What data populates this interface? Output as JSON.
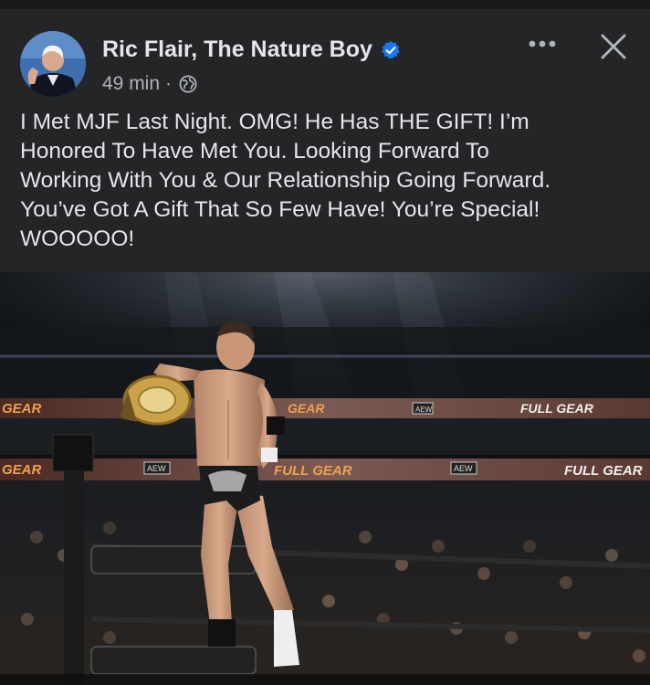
{
  "post": {
    "author_name": "Ric Flair, The Nature Boy",
    "timestamp": "49 min",
    "separator": "·",
    "audience_icon": "globe-icon",
    "verified_icon": "verified-badge-icon",
    "more_icon": "more-options-icon",
    "close_icon": "close-icon",
    "text": "I Met MJF Last Night. OMG! He Has THE GIFT! I’m\nHonored To Have Met You. Looking Forward To\nWorking With You & Our Relationship Going Forward.\nYou’ve Got A Gift That So Few Have! You’re Special!\nWOOOOO!"
  },
  "photo": {
    "banner_brand_1": "GEAR",
    "banner_brand_2": "FULL GEAR",
    "banner_logo": "AEW"
  },
  "colors": {
    "background": "#242526",
    "primary_text": "#e4e6eb",
    "secondary_text": "#b0b3b8",
    "verified_blue": "#1877f2"
  }
}
